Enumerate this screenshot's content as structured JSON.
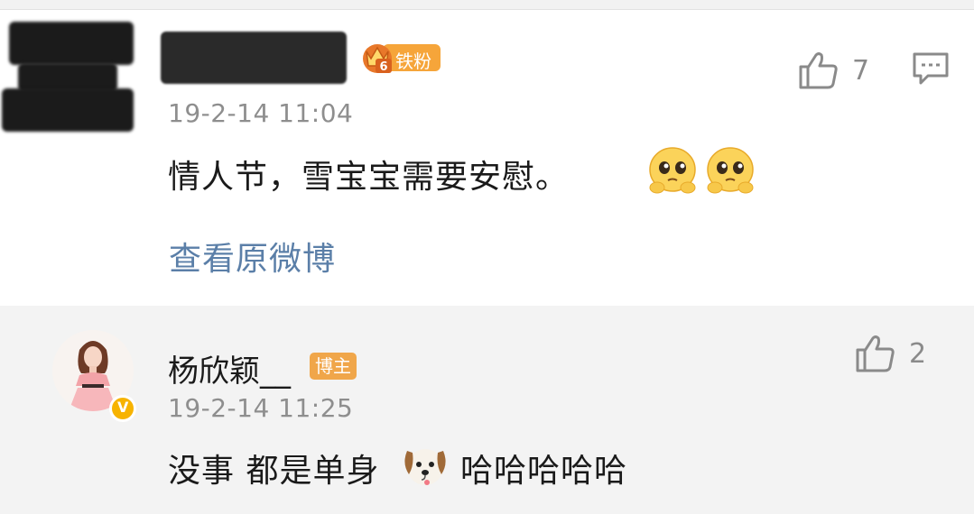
{
  "comment_main": {
    "badge_level": "6",
    "badge_label": "铁粉",
    "timestamp": "19-2-14 11:04",
    "text": "情人节，雪宝宝需要安慰。",
    "like_count": "7",
    "view_original_link": "查看原微博"
  },
  "reply": {
    "username": "杨欣颖__",
    "role_badge": "博主",
    "timestamp": "19-2-14 11:25",
    "text_before_emoji": "没事 都是单身",
    "text_after_emoji": "哈哈哈哈哈",
    "like_count": "2"
  },
  "colors": {
    "link": "#5b7fa8",
    "badge_orange": "#f6a53a",
    "reply_background": "#f3f3f3"
  }
}
